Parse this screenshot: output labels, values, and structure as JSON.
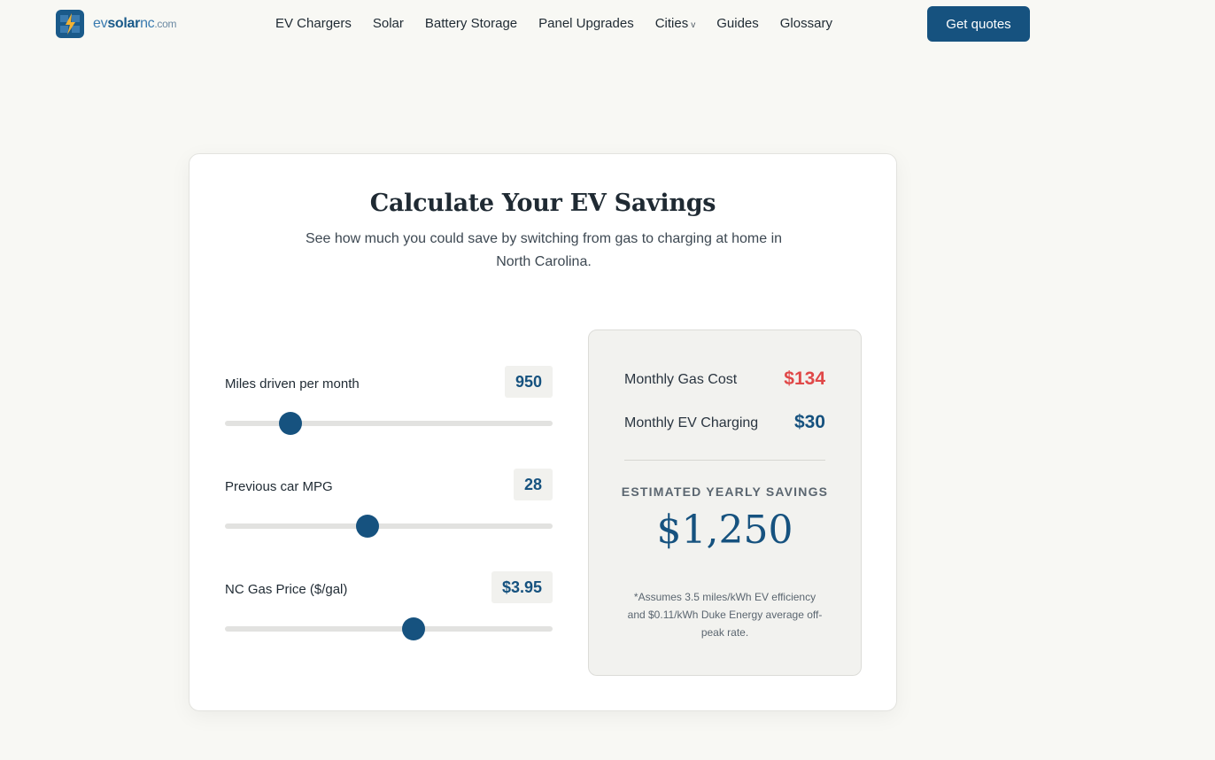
{
  "colors": {
    "brand": "#16527f",
    "gas_cost": "#e04848",
    "background": "#f8f8f4"
  },
  "header": {
    "logo": {
      "ev": "ev",
      "solar": "solar",
      "nc": "nc",
      "domain": ".com"
    },
    "nav": [
      {
        "label": "EV Chargers"
      },
      {
        "label": "Solar"
      },
      {
        "label": "Battery Storage"
      },
      {
        "label": "Panel Upgrades"
      },
      {
        "label": "Cities",
        "dropdown": "v"
      },
      {
        "label": "Guides"
      },
      {
        "label": "Glossary"
      }
    ],
    "cta_label": "Get quotes"
  },
  "calculator": {
    "title": "Calculate Your EV Savings",
    "subtitle": "See how much you could save by switching from gas to charging at home in North Carolina.",
    "sliders": [
      {
        "label": "Miles driven per month",
        "value_text": "950",
        "fill_fraction": 0.2
      },
      {
        "label": "Previous car MPG",
        "value_text": "28",
        "fill_fraction": 0.435
      },
      {
        "label": "NC Gas Price ($/gal)",
        "value_text": "$3.95",
        "fill_fraction": 0.575
      }
    ],
    "results": {
      "gas_cost_label": "Monthly Gas Cost",
      "gas_cost_value": "$134",
      "ev_cost_label": "Monthly EV Charging",
      "ev_cost_value": "$30",
      "savings_label": "ESTIMATED YEARLY SAVINGS",
      "savings_value": "$1,250",
      "footnote": "*Assumes 3.5 miles/kWh EV efficiency and $0.11/kWh Duke Energy average off-peak rate."
    }
  }
}
